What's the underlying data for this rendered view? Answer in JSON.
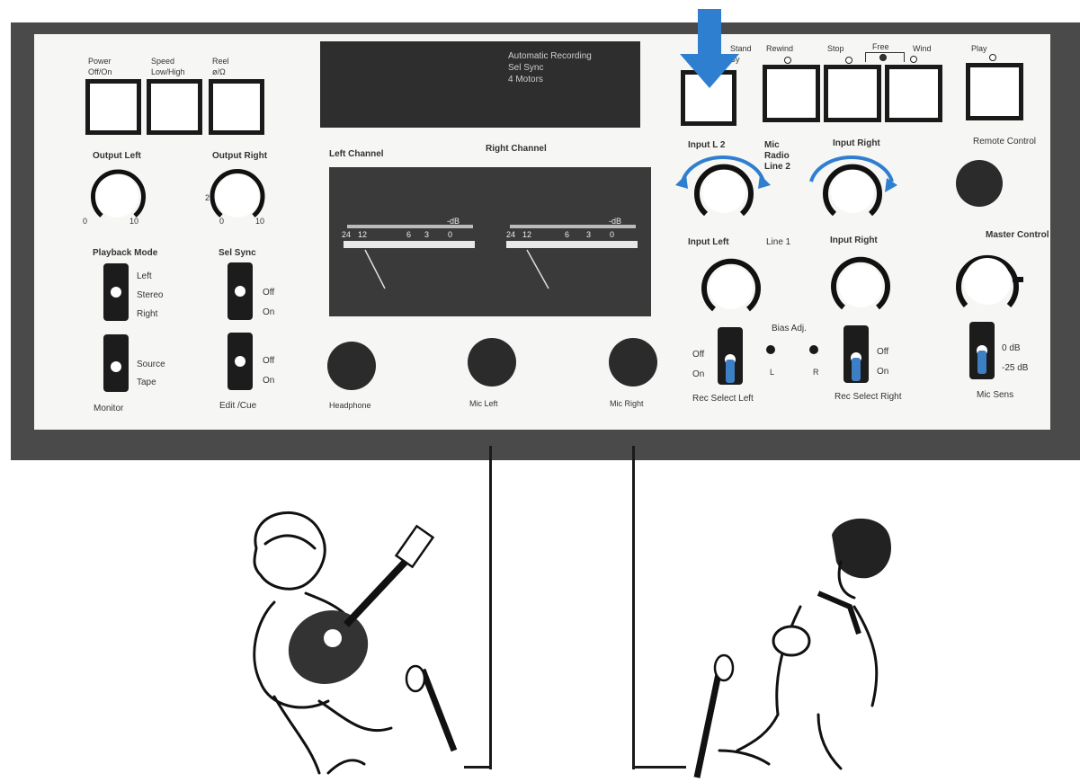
{
  "top_buttons": {
    "power": "Power\nOff/On",
    "speed": "Speed\nLow/High",
    "reel": "Reel\nø/Ω"
  },
  "display": {
    "lines": [
      "Automatic Recording",
      "Sel Sync",
      "4 Motors"
    ]
  },
  "transport": {
    "stand_by": "Stand\nBy",
    "rewind": "Rewind",
    "stop": "Stop",
    "free": "Free",
    "wind": "Wind",
    "play": "Play"
  },
  "output": {
    "left": "Output Left",
    "right": "Output Right",
    "scale_min": "0",
    "scale_max": "10",
    "scale_mid": "2"
  },
  "channels": {
    "left": "Left Channel",
    "right": "Right Channel"
  },
  "meter": {
    "db_label": "-dB",
    "scale_a": [
      "24",
      "12",
      "6",
      "3",
      "0"
    ],
    "scale_b": [
      "24",
      "12",
      "6",
      "3",
      "0"
    ]
  },
  "playback_mode": {
    "title": "Playback Mode",
    "options": [
      "Left",
      "Stereo",
      "Right"
    ]
  },
  "sel_sync": {
    "title": "Sel Sync",
    "off": "Off",
    "on": "On"
  },
  "monitor": {
    "title": "Monitor",
    "source": "Source",
    "tape": "Tape"
  },
  "edit_cue": {
    "title": "Edit /Cue",
    "off": "Off",
    "on": "On"
  },
  "inputs": {
    "input_l2": "Input L 2",
    "mic_radio_line": "Mic\nRadio\nLine 2",
    "input_right2": "Input Right",
    "input_left": "Input Left",
    "line1": "Line 1",
    "input_right": "Input Right",
    "remote": "Remote Control",
    "master": "Master Control"
  },
  "bias": {
    "title": "Bias Adj.",
    "l": "L",
    "r": "R"
  },
  "rec_select": {
    "left_title": "Rec Select Left",
    "right_title": "Rec Select Right",
    "off": "Off",
    "on": "On"
  },
  "mic_sens": {
    "title": "Mic Sens",
    "a": "0 dB",
    "b": "-25 dB"
  },
  "jacks": {
    "headphone": "Headphone",
    "mic_left": "Mic Left",
    "mic_right": "Mic Right"
  },
  "colors": {
    "accent_blue": "#2f7fd0",
    "panel_frame": "#4a4a4a",
    "panel_face": "#f6f6f4"
  }
}
